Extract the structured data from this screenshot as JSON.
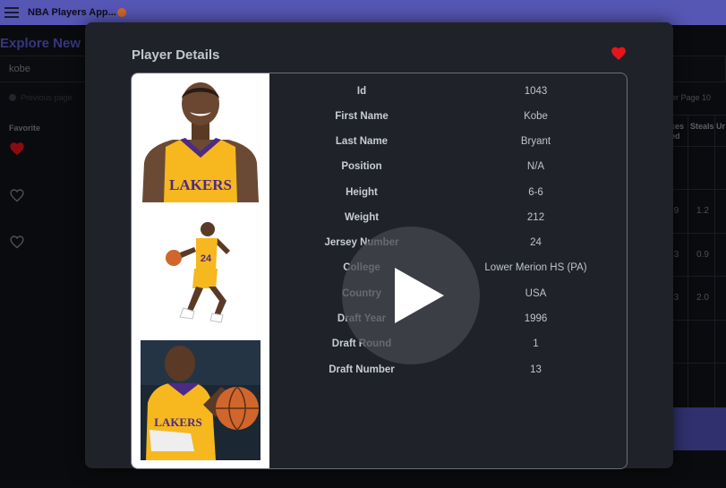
{
  "app": {
    "title": "NBA Players App..."
  },
  "explore": {
    "heading": "Explore New"
  },
  "search": {
    "value": "kobe"
  },
  "pagination": {
    "previous": "Previous page",
    "page_label": "er Page 10"
  },
  "favorites": {
    "title": "Favorite"
  },
  "table": {
    "headers": [
      "ces\ned",
      "Steals",
      "Ur"
    ],
    "rows": [
      [
        "",
        "",
        ""
      ],
      [
        ".9",
        "1.2",
        ""
      ],
      [
        ".3",
        "0.9",
        ""
      ],
      [
        ".3",
        "2.0",
        ""
      ],
      [
        "",
        "",
        ""
      ],
      [
        "",
        "",
        ""
      ]
    ]
  },
  "modal": {
    "title": "Player Details",
    "details": [
      {
        "label": "Id",
        "value": "1043"
      },
      {
        "label": "First Name",
        "value": "Kobe"
      },
      {
        "label": "Last Name",
        "value": "Bryant"
      },
      {
        "label": "Position",
        "value": "N/A"
      },
      {
        "label": "Height",
        "value": "6-6"
      },
      {
        "label": "Weight",
        "value": "212"
      },
      {
        "label": "Jersey Number",
        "value": "24"
      },
      {
        "label": "College",
        "value": "Lower Merion HS (PA)"
      },
      {
        "label": "Country",
        "value": "USA"
      },
      {
        "label": "Draft Year",
        "value": "1996"
      },
      {
        "label": "Draft Round",
        "value": "1"
      },
      {
        "label": "Draft Number",
        "value": "13"
      }
    ],
    "image_captions": [
      "LAKERS",
      "24",
      "LAKERS"
    ]
  },
  "colors": {
    "accent": "#5656b4",
    "heart": "#e8141b",
    "jersey": "#f6b81e",
    "lakers_purple": "#4d2a86"
  },
  "icons": [
    "hamburger-icon",
    "heart-icon",
    "play-icon"
  ]
}
